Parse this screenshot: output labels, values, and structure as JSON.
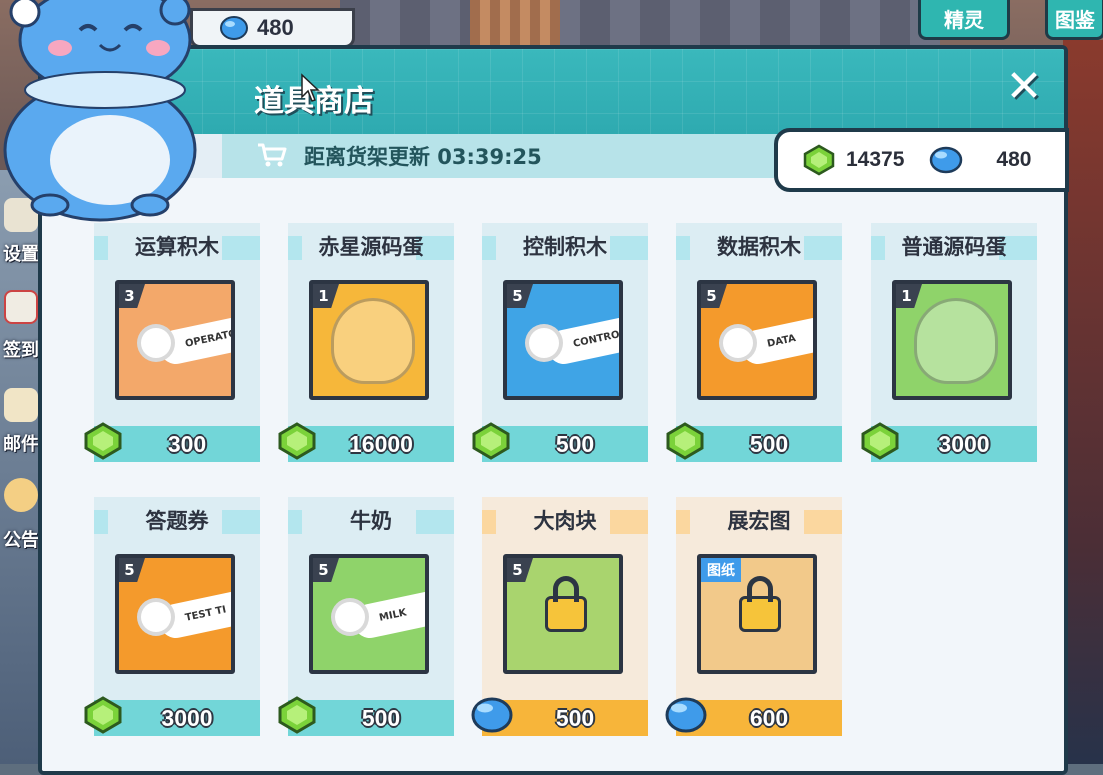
{
  "top_bar": {
    "gem_count": "480"
  },
  "top_tabs": [
    {
      "label": "精灵"
    },
    {
      "label": "图鉴"
    }
  ],
  "side_nav": [
    {
      "label": "设置"
    },
    {
      "label": "签到"
    },
    {
      "label": "邮件"
    },
    {
      "label": "公告"
    }
  ],
  "shop": {
    "title": "道具商店",
    "timer": "距离货架更新 03:39:25",
    "close_glyph": "✕"
  },
  "currency": {
    "green_gems": "14375",
    "blue_gems": "480"
  },
  "items": [
    {
      "name": "运算积木",
      "qty": "3",
      "price": "300",
      "currency": "green-gem",
      "locked": false,
      "icon": "operator-block-icon",
      "tile_color": "#f3a86a",
      "tag": "OPERATO"
    },
    {
      "name": "赤星源码蛋",
      "qty": "1",
      "price": "16000",
      "currency": "green-gem",
      "locked": false,
      "icon": "red-star-egg-icon",
      "tile_color": "#f6b73a"
    },
    {
      "name": "控制积木",
      "qty": "5",
      "price": "500",
      "currency": "green-gem",
      "locked": false,
      "icon": "control-block-icon",
      "tile_color": "#3fa4e6",
      "tag": "CONTRO"
    },
    {
      "name": "数据积木",
      "qty": "5",
      "price": "500",
      "currency": "green-gem",
      "locked": false,
      "icon": "data-block-icon",
      "tile_color": "#f49a2c",
      "tag": "DATA"
    },
    {
      "name": "普通源码蛋",
      "qty": "1",
      "price": "3000",
      "currency": "green-gem",
      "locked": false,
      "icon": "normal-egg-icon",
      "tile_color": "#8fd36a"
    },
    {
      "name": "答题券",
      "qty": "5",
      "price": "3000",
      "currency": "green-gem",
      "locked": false,
      "icon": "quiz-ticket-icon",
      "tile_color": "#f49a2c",
      "tag": "TEST TI"
    },
    {
      "name": "牛奶",
      "qty": "5",
      "price": "500",
      "currency": "green-gem",
      "locked": false,
      "icon": "milk-icon",
      "tile_color": "#8fd36a",
      "tag": "MILK"
    },
    {
      "name": "大肉块",
      "qty": "5",
      "price": "500",
      "currency": "blue-gem",
      "locked": true,
      "icon": "meat-icon",
      "tile_color": "#a9d46e"
    },
    {
      "name": "展宏图",
      "qty": "",
      "badge": "图纸",
      "price": "600",
      "currency": "blue-gem",
      "locked": true,
      "icon": "blueprint-icon",
      "tile_color": "#f2c98a"
    }
  ],
  "colors": {
    "teal": "#2eaab0",
    "green_gem": "#7bd23a",
    "blue_gem": "#3f9bea",
    "orange": "#f7b53a"
  }
}
